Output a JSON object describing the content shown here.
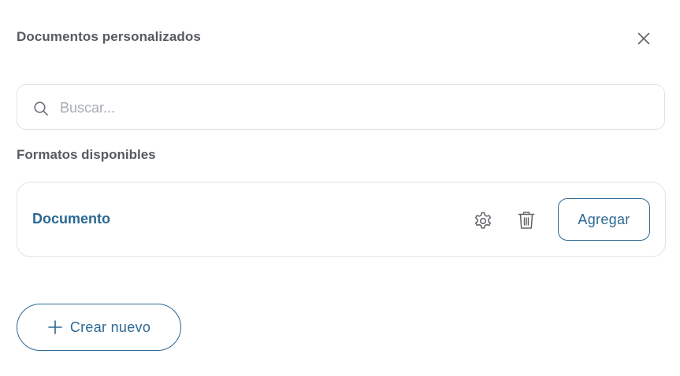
{
  "dialog": {
    "title": "Documentos personalizados"
  },
  "search": {
    "placeholder": "Buscar...",
    "value": "",
    "icon": "search-icon"
  },
  "formats": {
    "section_title": "Formatos disponibles",
    "items": [
      {
        "name": "Documento",
        "settings_icon": "gear-icon",
        "delete_icon": "trash-icon",
        "add_label": "Agregar"
      }
    ]
  },
  "actions": {
    "create_label": "Crear nuevo",
    "create_icon": "plus-icon"
  },
  "colors": {
    "accent": "#2b6893",
    "title_text": "#555b61",
    "border": "#dfe3e8",
    "placeholder": "#a7adb3"
  }
}
